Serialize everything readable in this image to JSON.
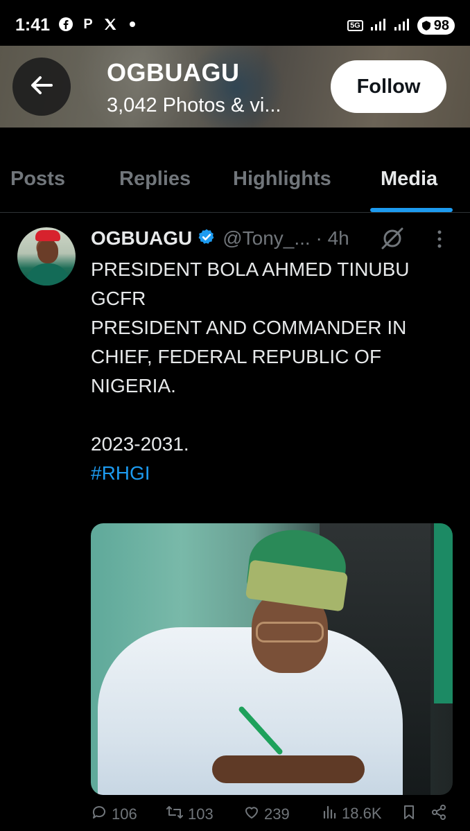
{
  "status_bar": {
    "time": "1:41",
    "battery": "98",
    "network": "5G",
    "left_icons": [
      "facebook-icon",
      "p-icon",
      "x-icon",
      "dot-icon"
    ],
    "right_icons": [
      "5g-icon",
      "signal-icon",
      "signal-icon",
      "battery-icon"
    ]
  },
  "header": {
    "title": "OGBUAGU",
    "subtitle": "3,042 Photos & vi...",
    "follow_label": "Follow"
  },
  "tabs": [
    {
      "label": "Posts",
      "active": false
    },
    {
      "label": "Replies",
      "active": false
    },
    {
      "label": "Highlights",
      "active": false
    },
    {
      "label": "Media",
      "active": true
    }
  ],
  "post": {
    "author": "OGBUAGU",
    "handle": "@Tony_... · 4h",
    "text": "PRESIDENT BOLA AHMED TINUBU\nGCFR\nPRESIDENT AND COMMANDER IN\nCHIEF, FEDERAL REPUBLIC OF\nNIGERIA.\n\n2023-2031.\n",
    "hashtag": "#RHGI",
    "stats": {
      "replies": "106",
      "reposts": "103",
      "likes": "239",
      "views": "18.6K"
    }
  },
  "colors": {
    "accent": "#1d9bf0",
    "muted": "#71767b",
    "text": "#e7e9ea",
    "background": "#000000"
  }
}
